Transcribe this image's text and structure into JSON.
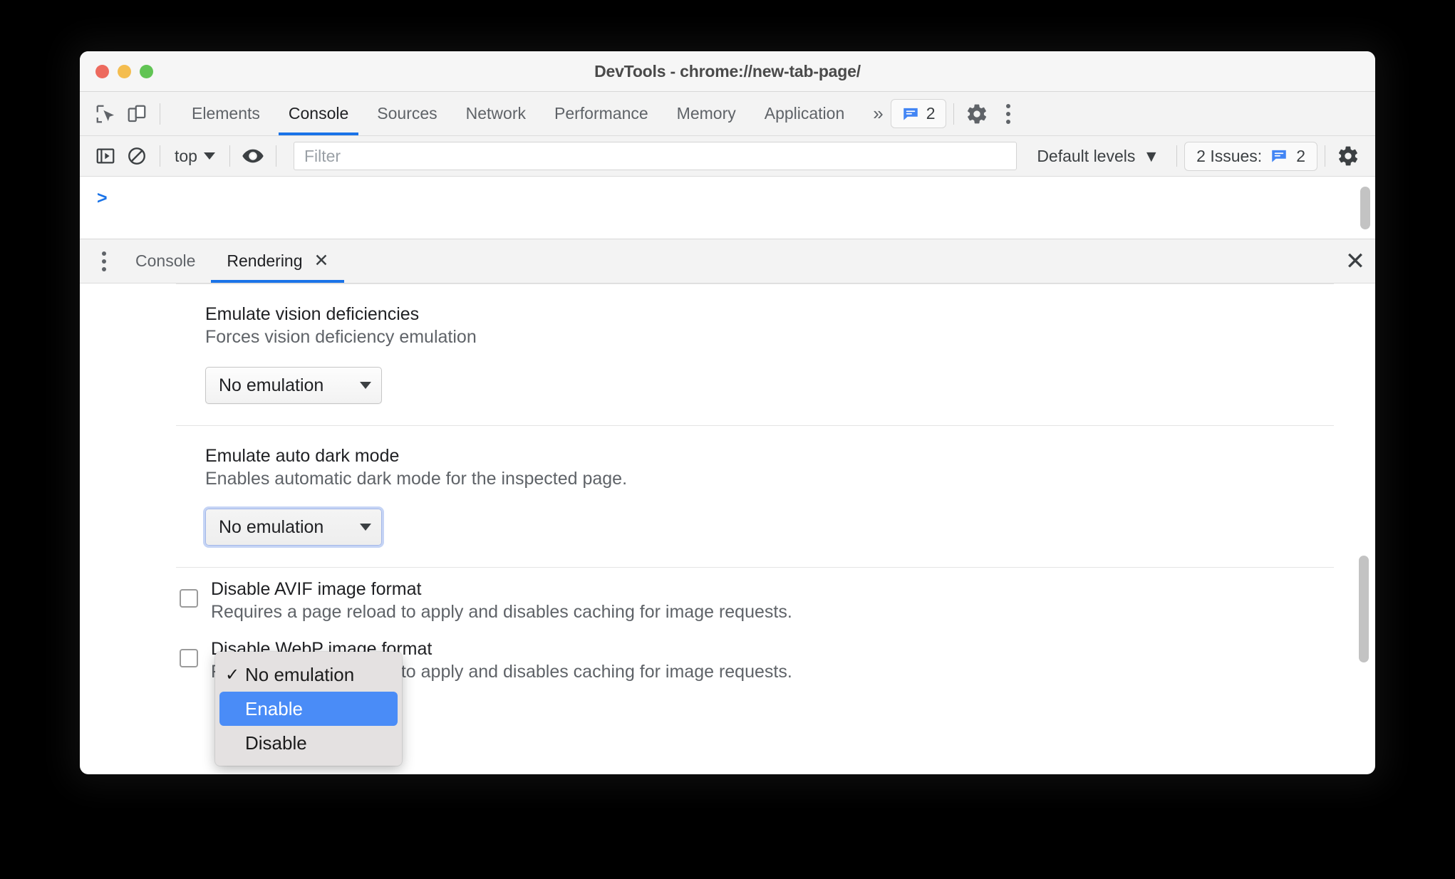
{
  "window": {
    "title": "DevTools - chrome://new-tab-page/",
    "traffic_lights": [
      "close",
      "minimize",
      "zoom"
    ],
    "colors": {
      "accent": "#1a73e8",
      "close_dot": "#ed6a5e",
      "minimize_dot": "#f4bd4f",
      "zoom_dot": "#61c454",
      "menu_highlight": "#4a8cf7"
    }
  },
  "main_tabbar": {
    "icons": [
      {
        "name": "inspect-element-icon",
        "glyph": "cursor-in-box"
      },
      {
        "name": "device-toolbar-icon",
        "glyph": "phone-tablet"
      }
    ],
    "tabs": [
      {
        "label": "Elements",
        "active": false
      },
      {
        "label": "Console",
        "active": true
      },
      {
        "label": "Sources",
        "active": false
      },
      {
        "label": "Network",
        "active": false
      },
      {
        "label": "Performance",
        "active": false
      },
      {
        "label": "Memory",
        "active": false
      },
      {
        "label": "Application",
        "active": false
      }
    ],
    "more_tabs_label": "»",
    "issues_badge": {
      "count": "2",
      "icon": "issues-message-icon"
    },
    "settings_icon": "gear-icon",
    "more_options_icon": "kebab-menu-icon"
  },
  "console_toolbar": {
    "sidebar_toggle_icon": "console-sidebar-icon",
    "clear_console_icon": "clear-console-icon",
    "context_selector": {
      "value": "top",
      "caret": "▼"
    },
    "live_expression_icon": "eye-icon",
    "filter": {
      "placeholder": "Filter",
      "value": ""
    },
    "log_levels": {
      "label": "Default levels",
      "caret": "▼"
    },
    "issues_counter": {
      "label": "2 Issues:",
      "count": "2",
      "icon": "issues-message-icon"
    },
    "settings_icon": "gear-icon"
  },
  "console_body": {
    "prompt": ">"
  },
  "drawer": {
    "more_tools_icon": "kebab-menu-icon",
    "tabs": [
      {
        "label": "Console",
        "active": false,
        "closable": false
      },
      {
        "label": "Rendering",
        "active": true,
        "closable": true,
        "close_glyph": "✕"
      }
    ],
    "close_drawer_glyph": "✕"
  },
  "rendering": {
    "sections": [
      {
        "name": "emulate-vision-deficiencies",
        "title": "Emulate vision deficiencies",
        "description": "Forces vision deficiency emulation",
        "select_value": "No emulation"
      },
      {
        "name": "emulate-auto-dark-mode",
        "title": "Emulate auto dark mode",
        "description": "Enables automatic dark mode for the inspected page.",
        "select_value": "No emulation"
      }
    ],
    "checkboxes": [
      {
        "name": "disable-avif-image-format",
        "title": "Disable AVIF image format",
        "description": "Requires a page reload to apply and disables caching for image requests.",
        "checked": false
      },
      {
        "name": "disable-webp-image-format",
        "title": "Disable WebP image format",
        "description": "Requires a page reload to apply and disables caching for image requests.",
        "checked": false
      }
    ]
  },
  "dropdown_menu": {
    "open": true,
    "owner": "emulate-auto-dark-mode",
    "items": [
      {
        "label": "No emulation",
        "checked": true,
        "highlighted": false,
        "tick": "✓"
      },
      {
        "label": "Enable",
        "checked": false,
        "highlighted": true,
        "tick": ""
      },
      {
        "label": "Disable",
        "checked": false,
        "highlighted": false,
        "tick": ""
      }
    ]
  }
}
